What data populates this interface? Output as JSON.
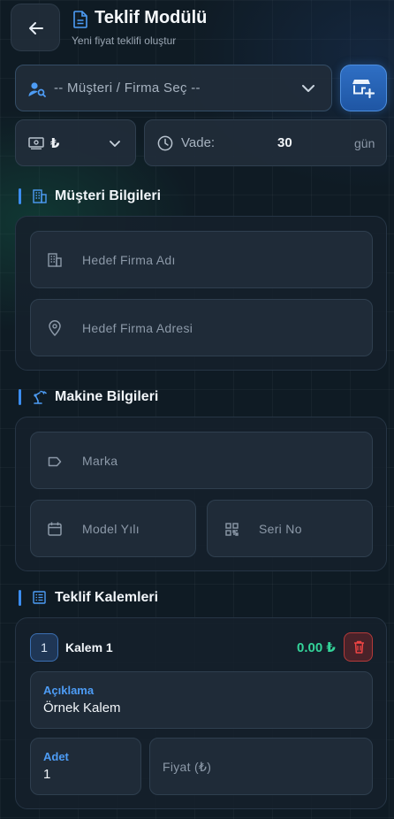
{
  "header": {
    "title": "Teklif Modülü",
    "subtitle": "Yeni fiyat teklifi oluştur"
  },
  "customer_select": {
    "placeholder": "-- Müşteri / Firma Seç --"
  },
  "currency": {
    "selected": "₺"
  },
  "term": {
    "label": "Vade:",
    "value": "30",
    "unit": "gün"
  },
  "sections": {
    "customer": "Müşteri Bilgileri",
    "machine": "Makine Bilgileri",
    "items": "Teklif Kalemleri"
  },
  "customer_form": {
    "company_name_placeholder": "Hedef Firma Adı",
    "company_address_placeholder": "Hedef Firma Adresi"
  },
  "machine_form": {
    "brand_placeholder": "Marka",
    "model_year_placeholder": "Model Yılı",
    "serial_placeholder": "Seri No"
  },
  "items": [
    {
      "index": "1",
      "title": "Kalem 1",
      "total": "0.00 ₺",
      "description_label": "Açıklama",
      "description_value": "Örnek Kalem",
      "quantity_label": "Adet",
      "quantity_value": "1",
      "price_placeholder": "Fiyat (₺)"
    }
  ],
  "colors": {
    "accent": "#3b8df0",
    "success": "#34d399",
    "danger": "#ef4444",
    "background": "#0f1b24"
  }
}
